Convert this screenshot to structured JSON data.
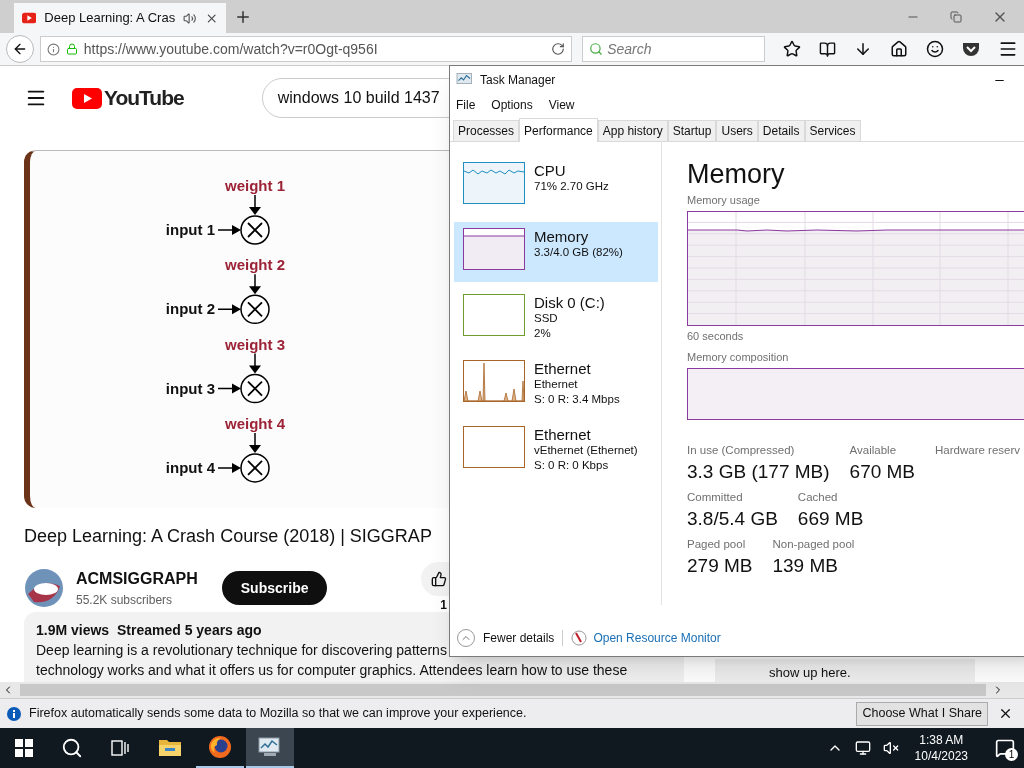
{
  "browser": {
    "tab": {
      "title": "Deep Learning: A Cras",
      "selected": true,
      "playing": true
    },
    "url": "https://www.youtube.com/watch?v=r0Ogt-q956I",
    "search": {
      "placeholder": "Search"
    }
  },
  "youtube": {
    "logo": "YouTube",
    "search_query": "windows 10 build 1437",
    "diagram": [
      {
        "weight": "weight 1",
        "input": "input 1"
      },
      {
        "weight": "weight 2",
        "input": "input 2"
      },
      {
        "weight": "weight 3",
        "input": "input 3"
      },
      {
        "weight": "weight 4",
        "input": "input 4"
      }
    ],
    "video_title": "Deep Learning: A Crash Course (2018) | SIGGRAP",
    "channel": {
      "name": "ACMSIGGRAPH",
      "subscribers": "55.2K subscribers"
    },
    "subscribe": "Subscribe",
    "like_count": "1",
    "description": {
      "stats": "1.9M views  Streamed 5 years ago",
      "lines": [
        "Deep learning is a revolutionary technique for discovering patterns",
        "technology works and what it offers us for computer graphics. Attendees learn how to use these"
      ]
    },
    "side_note": "show up here."
  },
  "task_manager": {
    "title": "Task Manager",
    "menu": [
      "File",
      "Options",
      "View"
    ],
    "tabs": [
      {
        "label": "Processes",
        "selected": false
      },
      {
        "label": "Performance",
        "selected": true
      },
      {
        "label": "App history",
        "selected": false
      },
      {
        "label": "Startup",
        "selected": false
      },
      {
        "label": "Users",
        "selected": false
      },
      {
        "label": "Details",
        "selected": false
      },
      {
        "label": "Services",
        "selected": false
      }
    ],
    "resources": [
      {
        "kind": "cpu",
        "name": "CPU",
        "details": [
          "71%  2.70 GHz"
        ],
        "color": "#1f8fbf",
        "selected": false
      },
      {
        "kind": "memory",
        "name": "Memory",
        "details": [
          "3.3/4.0 GB (82%)"
        ],
        "color": "#8b3aa0",
        "selected": true
      },
      {
        "kind": "disk",
        "name": "Disk 0 (C:)",
        "details": [
          "SSD",
          "2%"
        ],
        "color": "#6f9e2e",
        "selected": false
      },
      {
        "kind": "network-busy",
        "name": "Ethernet",
        "details": [
          "Ethernet",
          "S: 0 R: 3.4 Mbps"
        ],
        "color": "#a8662b",
        "selected": false
      },
      {
        "kind": "network-idle",
        "name": "Ethernet",
        "details": [
          "vEthernet (Ethernet)",
          "S: 0 R: 0 Kbps"
        ],
        "color": "#a8662b",
        "selected": false
      }
    ],
    "heading": "Memory",
    "usage_label": "Memory usage",
    "time_label": "60 seconds",
    "composition_label": "Memory composition",
    "stats": [
      [
        {
          "label": "In use (Compressed)",
          "value": "3.3 GB (177 MB)"
        },
        {
          "label": "Available",
          "value": "670 MB"
        },
        {
          "label": "Hardware reserv"
        }
      ],
      [
        {
          "label": "Committed",
          "value": "3.8/5.4 GB"
        },
        {
          "label": "Cached",
          "value": "669 MB"
        }
      ],
      [
        {
          "label": "Paged pool",
          "value": "279 MB"
        },
        {
          "label": "Non-paged pool",
          "value": "139 MB"
        }
      ]
    ],
    "footer": {
      "fewer": "Fewer details",
      "link": "Open Resource Monitor"
    }
  },
  "notification": {
    "text": "Firefox automatically sends some data to Mozilla so that we can improve your experience.",
    "button": "Choose What I Share"
  },
  "taskbar": {
    "apps": [
      {
        "kind": "explorer",
        "running": false,
        "selected": false
      },
      {
        "kind": "firefox",
        "running": true,
        "selected": false
      },
      {
        "kind": "task-manager",
        "running": true,
        "selected": true
      }
    ],
    "time": "1:38 AM",
    "date": "10/4/2023",
    "notifications": "1"
  }
}
